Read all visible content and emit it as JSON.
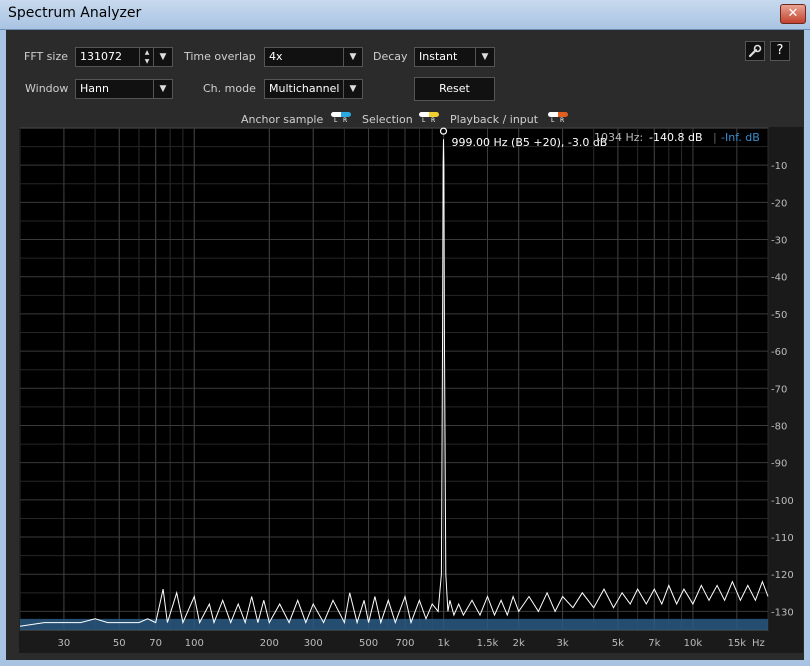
{
  "window": {
    "title": "Spectrum Analyzer",
    "close_glyph": "✕"
  },
  "controls": {
    "fft_size": {
      "label": "FFT size",
      "value": "131072"
    },
    "time_overlap": {
      "label": "Time overlap",
      "value": "4x"
    },
    "decay": {
      "label": "Decay",
      "value": "Instant"
    },
    "window_fn": {
      "label": "Window",
      "value": "Hann"
    },
    "ch_mode": {
      "label": "Ch. mode",
      "value": "Multichannel"
    },
    "reset_label": "Reset",
    "help_glyph": "?"
  },
  "icons": {
    "settings": "wrench-icon",
    "help": "question-icon",
    "dropdown": "chevron-down-icon",
    "spin": "spin-arrows-icon"
  },
  "legend": [
    {
      "label": "Anchor sample",
      "color": "#2aa8e0"
    },
    {
      "label": "Selection",
      "color": "#f0d030"
    },
    {
      "label": "Playback / input",
      "color": "#e06020"
    }
  ],
  "readout": {
    "freq": "1034 Hz:",
    "level": "-140.8 dB",
    "right": "-Inf. dB"
  },
  "chart_data": {
    "type": "line",
    "title": "",
    "xlabel": "Hz",
    "ylabel": "",
    "x_scale": "log",
    "xlim": [
      20,
      20000
    ],
    "ylim": [
      -135,
      0
    ],
    "grid": true,
    "x_ticks": [
      {
        "v": 30,
        "label": "30"
      },
      {
        "v": 50,
        "label": "50"
      },
      {
        "v": 70,
        "label": "70"
      },
      {
        "v": 100,
        "label": "100"
      },
      {
        "v": 200,
        "label": "200"
      },
      {
        "v": 300,
        "label": "300"
      },
      {
        "v": 500,
        "label": "500"
      },
      {
        "v": 700,
        "label": "700"
      },
      {
        "v": 1000,
        "label": "1k"
      },
      {
        "v": 1500,
        "label": "1.5k"
      },
      {
        "v": 2000,
        "label": "2k"
      },
      {
        "v": 3000,
        "label": "3k"
      },
      {
        "v": 5000,
        "label": "5k"
      },
      {
        "v": 7000,
        "label": "7k"
      },
      {
        "v": 10000,
        "label": "10k"
      },
      {
        "v": 15000,
        "label": "15k"
      }
    ],
    "y_ticks": [
      -10,
      -20,
      -30,
      -40,
      -50,
      -60,
      -70,
      -80,
      -90,
      -100,
      -110,
      -120,
      -130
    ],
    "y_tick_labels": [
      "-10",
      "-20",
      "-30",
      "-40",
      "-50",
      "-60",
      "-70",
      "-80",
      "-90",
      "-100",
      "-110",
      "-120",
      "-130"
    ],
    "peak": {
      "x": 999,
      "y": -3.0,
      "label": "999.00 Hz (B5 +20), -3.0 dB"
    },
    "series": [
      {
        "color": "#ffffff",
        "points": [
          [
            20,
            -134
          ],
          [
            25,
            -133
          ],
          [
            30,
            -133
          ],
          [
            35,
            -133
          ],
          [
            40,
            -132
          ],
          [
            45,
            -133
          ],
          [
            50,
            -133
          ],
          [
            55,
            -133
          ],
          [
            60,
            -133
          ],
          [
            65,
            -132
          ],
          [
            70,
            -133
          ],
          [
            75,
            -124
          ],
          [
            78,
            -133
          ],
          [
            85,
            -125
          ],
          [
            90,
            -133
          ],
          [
            100,
            -126
          ],
          [
            105,
            -133
          ],
          [
            115,
            -128
          ],
          [
            120,
            -133
          ],
          [
            130,
            -127
          ],
          [
            140,
            -133
          ],
          [
            150,
            -128
          ],
          [
            160,
            -133
          ],
          [
            170,
            -126
          ],
          [
            180,
            -133
          ],
          [
            190,
            -127
          ],
          [
            200,
            -133
          ],
          [
            220,
            -128
          ],
          [
            240,
            -133
          ],
          [
            260,
            -127
          ],
          [
            280,
            -133
          ],
          [
            300,
            -128
          ],
          [
            330,
            -133
          ],
          [
            360,
            -127
          ],
          [
            400,
            -133
          ],
          [
            420,
            -125
          ],
          [
            450,
            -133
          ],
          [
            480,
            -127
          ],
          [
            500,
            -133
          ],
          [
            530,
            -126
          ],
          [
            560,
            -133
          ],
          [
            600,
            -127
          ],
          [
            640,
            -133
          ],
          [
            700,
            -126
          ],
          [
            740,
            -133
          ],
          [
            800,
            -127
          ],
          [
            850,
            -132
          ],
          [
            900,
            -128
          ],
          [
            950,
            -130
          ],
          [
            980,
            -120
          ],
          [
            990,
            -60
          ],
          [
            995,
            -10
          ],
          [
            999,
            -3
          ],
          [
            1003,
            -10
          ],
          [
            1008,
            -60
          ],
          [
            1020,
            -120
          ],
          [
            1040,
            -130
          ],
          [
            1060,
            -127
          ],
          [
            1100,
            -131
          ],
          [
            1150,
            -128
          ],
          [
            1200,
            -131
          ],
          [
            1300,
            -127
          ],
          [
            1400,
            -131
          ],
          [
            1500,
            -126
          ],
          [
            1600,
            -131
          ],
          [
            1700,
            -127
          ],
          [
            1800,
            -131
          ],
          [
            1900,
            -126
          ],
          [
            2000,
            -130
          ],
          [
            2200,
            -126
          ],
          [
            2400,
            -130
          ],
          [
            2600,
            -125
          ],
          [
            2800,
            -130
          ],
          [
            3000,
            -126
          ],
          [
            3300,
            -129
          ],
          [
            3600,
            -125
          ],
          [
            4000,
            -129
          ],
          [
            4400,
            -124
          ],
          [
            4800,
            -129
          ],
          [
            5200,
            -125
          ],
          [
            5600,
            -128
          ],
          [
            6000,
            -124
          ],
          [
            6500,
            -128
          ],
          [
            7000,
            -124
          ],
          [
            7500,
            -128
          ],
          [
            8000,
            -123
          ],
          [
            8600,
            -128
          ],
          [
            9200,
            -124
          ],
          [
            10000,
            -128
          ],
          [
            10800,
            -123
          ],
          [
            11600,
            -127
          ],
          [
            12500,
            -123
          ],
          [
            13400,
            -127
          ],
          [
            14400,
            -122
          ],
          [
            15500,
            -127
          ],
          [
            16600,
            -123
          ],
          [
            17800,
            -127
          ],
          [
            19000,
            -122
          ],
          [
            20000,
            -126
          ]
        ]
      }
    ]
  }
}
